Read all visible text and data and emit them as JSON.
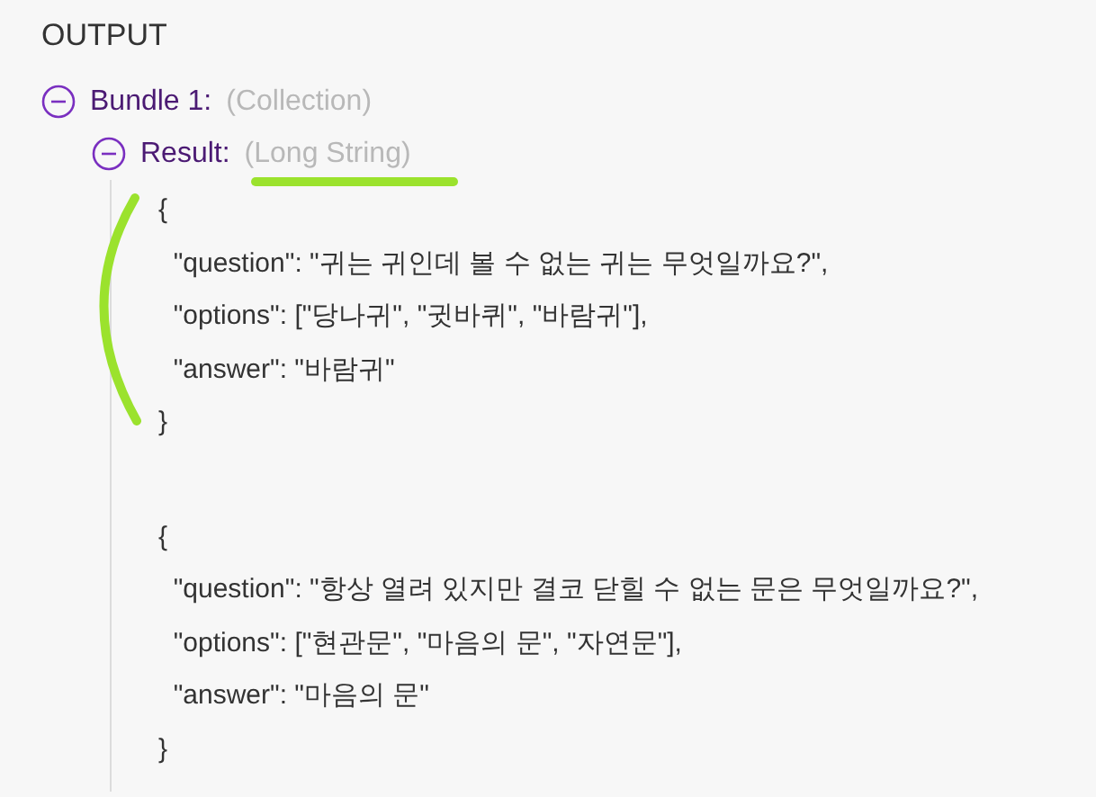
{
  "heading": "OUTPUT",
  "tree": [
    {
      "label": "Bundle 1:",
      "type": "(Collection)",
      "expanded": true,
      "children": [
        {
          "label": "Result:",
          "type": "(Long String)",
          "expanded": true,
          "blocks": [
            [
              "{",
              "  \"question\": \"귀는 귀인데 볼 수 없는 귀는 무엇일까요?\",",
              "  \"options\": [\"당나귀\", \"귓바퀴\", \"바람귀\"],",
              "  \"answer\": \"바람귀\"",
              "}"
            ],
            [
              "{",
              "  \"question\": \"항상 열려 있지만 결코 닫힐 수 없는 문은 무엇일까요?\",",
              "  \"options\": [\"현관문\", \"마음의 문\", \"자연문\"],",
              "  \"answer\": \"마음의 문\"",
              "}"
            ]
          ]
        }
      ]
    }
  ]
}
